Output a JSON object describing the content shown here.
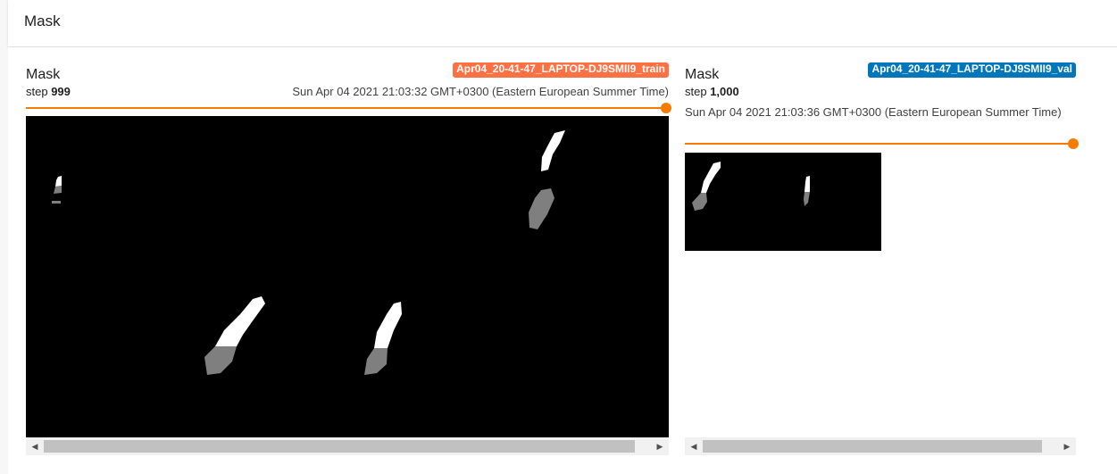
{
  "header": {
    "title": "Mask"
  },
  "cards": {
    "train": {
      "title": "Mask",
      "step_prefix": "step ",
      "step": "999",
      "run_tag": "Apr04_20-41-47_LAPTOP-DJ9SMII9_train",
      "tag_color": "#ff7043",
      "timestamp": "Sun Apr 04 2021 21:03:32 GMT+0300 (Eastern European Summer Time)",
      "slider_fraction": 1.0
    },
    "val": {
      "title": "Mask",
      "step_prefix": "step ",
      "step": "1,000",
      "run_tag": "Apr04_20-41-47_LAPTOP-DJ9SMII9_val",
      "tag_color": "#0077bb",
      "timestamp": "Sun Apr 04 2021 21:03:36 GMT+0300 (Eastern European Summer Time)",
      "slider_fraction": 1.0
    }
  },
  "scroll": {
    "left_arrow": "◀",
    "right_arrow": "▶"
  },
  "colors": {
    "accent": "#f57c00",
    "mask_fg": "#ffffff",
    "mask_bg": "#7f7f7f",
    "image_bg": "#000000"
  }
}
